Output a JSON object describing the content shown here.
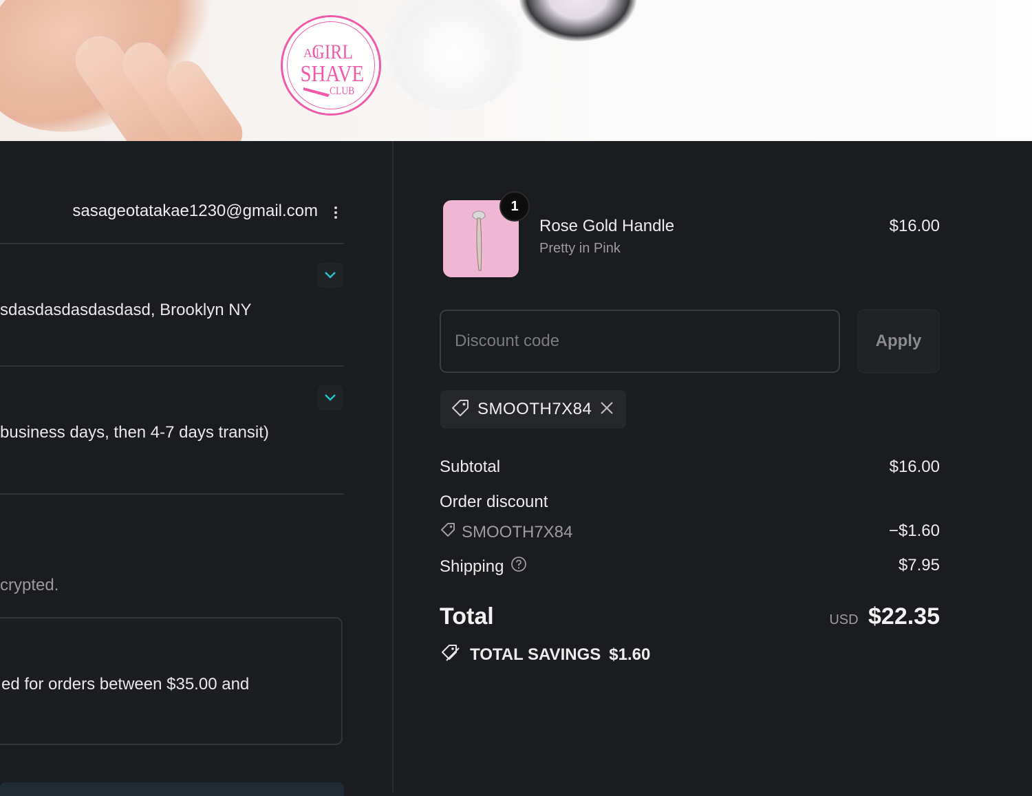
{
  "brand": {
    "logo_text": [
      "All",
      "GIRL",
      "SHAVE",
      "CLUB"
    ],
    "logo_color": "#ef5aa8"
  },
  "contact": {
    "email": "sasageotatakae1230@gmail.com"
  },
  "sections": {
    "ship_to_value": "sdasdasdasdasdasd, Brooklyn NY",
    "method_value": "business days, then 4-7 days transit)",
    "payment_note": "crypted.",
    "notice_text": "ed for orders between $35.00 and"
  },
  "cart": {
    "items": [
      {
        "name": "Rose Gold Handle",
        "variant": "Pretty in Pink",
        "price": "$16.00",
        "quantity": "1"
      }
    ]
  },
  "discount": {
    "placeholder": "Discount code",
    "apply_label": "Apply",
    "applied_code": "SMOOTH7X84"
  },
  "summary": {
    "subtotal_label": "Subtotal",
    "subtotal_value": "$16.00",
    "order_discount_label": "Order discount",
    "order_discount_code": "SMOOTH7X84",
    "order_discount_value": "−$1.60",
    "shipping_label": "Shipping",
    "shipping_value": "$7.95",
    "total_label": "Total",
    "currency": "USD",
    "total_value": "$22.35",
    "savings_label": "TOTAL SAVINGS",
    "savings_value": "$1.60"
  },
  "colors": {
    "background": "#1b1c1f",
    "accent_teal": "#27c0cf",
    "product_bg": "#f0b7d5"
  },
  "icons": [
    "kebab-menu-icon",
    "chevron-down-icon",
    "tag-icon",
    "close-icon",
    "help-circle-icon",
    "savings-tag-icon"
  ]
}
